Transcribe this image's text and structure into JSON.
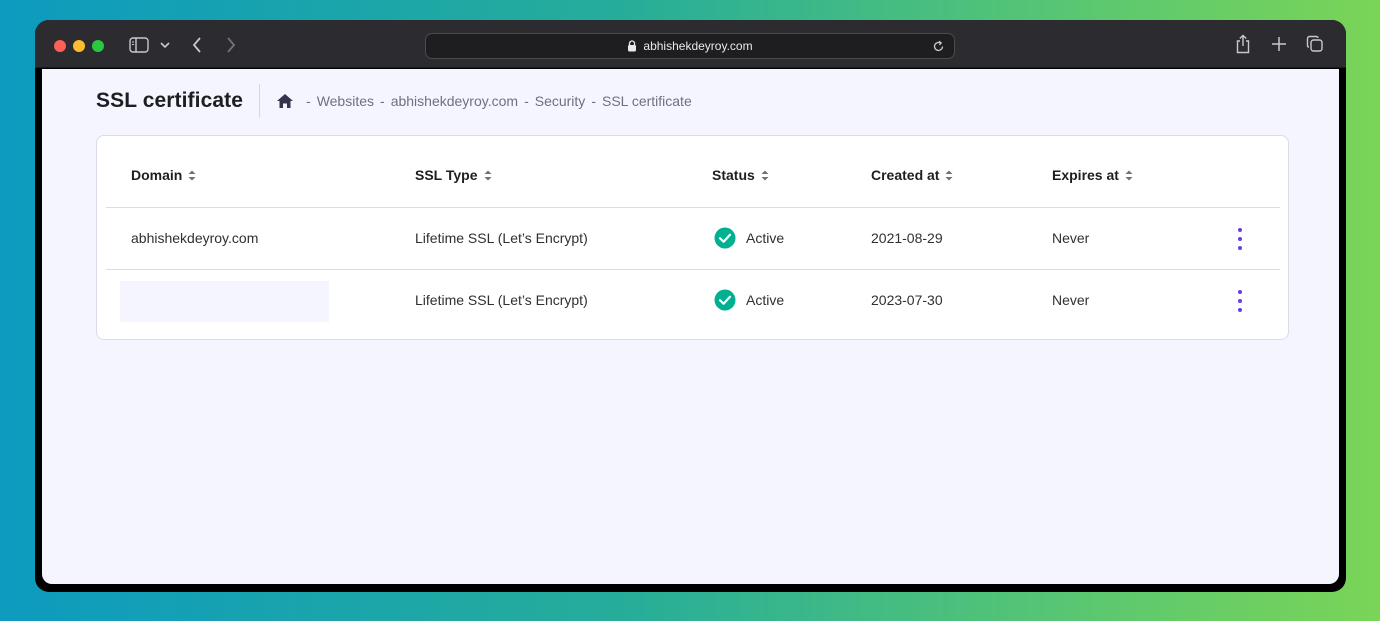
{
  "browser": {
    "url": "abhishekdeyroy.com"
  },
  "page": {
    "title": "SSL certificate",
    "breadcrumb": {
      "separator": "-",
      "items": [
        "Websites",
        "abhishekdeyroy.com",
        "Security",
        "SSL certificate"
      ]
    }
  },
  "table": {
    "columns": [
      "Domain",
      "SSL Type",
      "Status",
      "Created at",
      "Expires at"
    ],
    "rows": [
      {
        "domain": "abhishekdeyroy.com",
        "ssl_type": "Lifetime SSL (Let’s Encrypt)",
        "status": "Active",
        "created_at": "2021-08-29",
        "expires_at": "Never"
      },
      {
        "domain": "",
        "ssl_type": "Lifetime SSL (Let’s Encrypt)",
        "status": "Active",
        "created_at": "2023-07-30",
        "expires_at": "Never"
      }
    ]
  },
  "colors": {
    "accent": "#673de6",
    "success": "#00b090",
    "page_bg": "#f4f5ff"
  }
}
